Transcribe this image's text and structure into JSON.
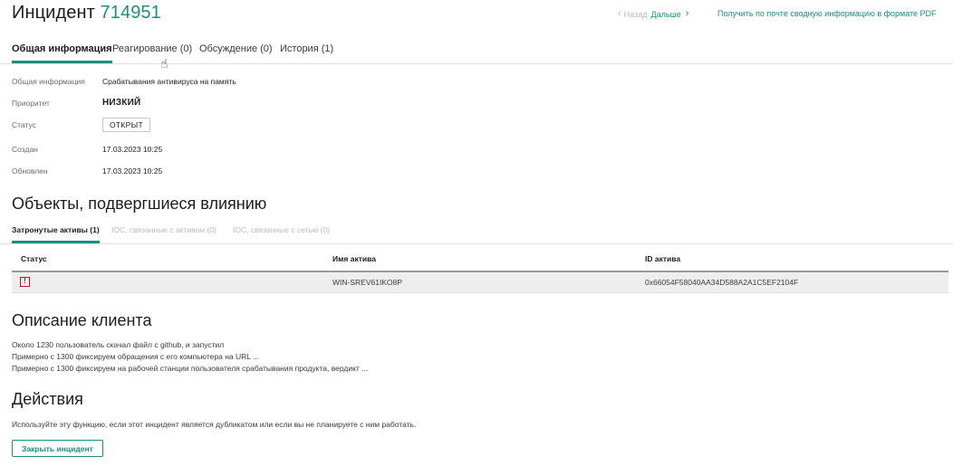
{
  "header": {
    "title": "Инцидент",
    "incident_number": "714951",
    "prev_label": "Назад",
    "next_label": "Дальше",
    "pdf_link": "Получить по почте сводную информацию в формате PDF"
  },
  "tabs": [
    {
      "label": "Общая информация",
      "active": true
    },
    {
      "label": "Реагирование (0)",
      "active": false
    },
    {
      "label": "Обсуждение (0)",
      "active": false
    },
    {
      "label": "История (1)",
      "active": false
    }
  ],
  "general": {
    "summary_label": "Общая информация",
    "summary_value": "Срабатывания антивируса на память",
    "priority_label": "Приоритет",
    "priority_value": "НИЗКИЙ",
    "status_label": "Статус",
    "status_value": "ОТКРЫТ",
    "created_label": "Создан",
    "created_value": "17.03.2023 10:25",
    "updated_label": "Обновлен",
    "updated_value": "17.03.2023 10:25"
  },
  "affected": {
    "title": "Объекты, подвергшиеся влиянию",
    "subtabs": [
      {
        "label": "Затронутые активы (1)",
        "active": true
      },
      {
        "label": "IOC, связанные с активом (0)",
        "active": false
      },
      {
        "label": "IOC, связанные с сетью (0)",
        "active": false
      }
    ],
    "columns": [
      "Статус",
      "Имя актива",
      "ID актива"
    ],
    "rows": [
      {
        "status_icon": "warning-icon",
        "name": "WIN-SREV61IKO8P",
        "id": "0x66054F58040AA34D588A2A1C5EF2104F"
      }
    ],
    "status_color": "#c8102e"
  },
  "client": {
    "title": "Описание клиента",
    "lines": [
      "Около 1230 пользователь скачал файл с github, и запустил",
      "Примерно с 1300 фиксируем обращения с его компьютера на URL ...",
      "Примерно с 1300 фиксируем на рабочей станции пользователя срабатывания продукта, вердикт ..."
    ]
  },
  "actions": {
    "title": "Действия",
    "description": "Используйте эту функцию, если этот инцидент является дубликатом или если вы не планируете с ним работать.",
    "close_button": "Закрыть инцидент"
  },
  "colors": {
    "accent": "#1a8f80",
    "alert": "#c8102e"
  }
}
